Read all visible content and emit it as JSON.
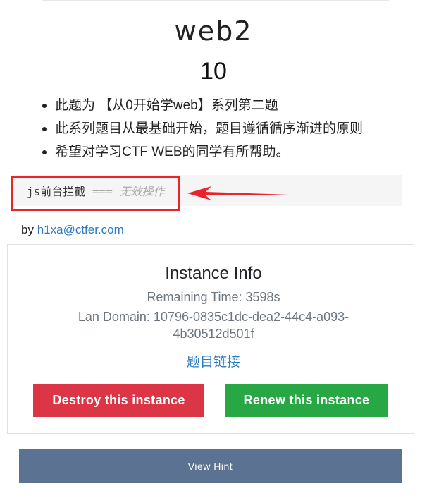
{
  "challenge": {
    "title": "web2",
    "score": "10",
    "description": [
      "此题为 【从0开始学web】系列第二题",
      "此系列题目从最基础开始，题目遵循循序渐进的原则",
      "希望对学习CTF WEB的同学有所帮助。"
    ],
    "code": {
      "keyword": "js前台拦截",
      "operator": "===",
      "comment": "无效操作"
    },
    "author_prefix": "by",
    "author_email": "h1xa@ctfer.com"
  },
  "instance": {
    "title": "Instance Info",
    "remaining": "Remaining Time: 3598s",
    "lan_domain": "Lan Domain: 10796-0835c1dc-dea2-44c4-a093-4b30512d501f",
    "link": "题目链接",
    "destroy_label": "Destroy this instance",
    "renew_label": "Renew this instance"
  },
  "hint_label": "View Hint",
  "colors": {
    "destroy": "#dc3545",
    "renew": "#28a745",
    "hint": "#5c7292",
    "link": "#2a7bbf",
    "annotation": "#e8252e"
  }
}
